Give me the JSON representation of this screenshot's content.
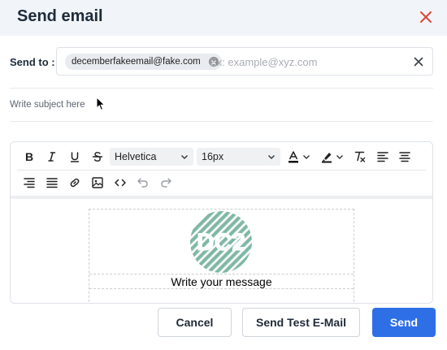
{
  "dialog": {
    "title": "Send email"
  },
  "recipients": {
    "label": "Send to :",
    "chips": [
      "decemberfakeemail@fake.com"
    ],
    "placeholder": "Ex: example@xyz.com"
  },
  "subject": {
    "placeholder": "Write subject here"
  },
  "toolbar": {
    "font_family": "Helvetica",
    "font_size": "16px",
    "buttons": [
      "bold",
      "italic",
      "underline",
      "strikethrough",
      "text-color",
      "highlight",
      "clear-format",
      "align-left",
      "align-center",
      "align-right",
      "justify",
      "link",
      "image",
      "code",
      "undo",
      "redo"
    ]
  },
  "editor": {
    "logo_text": "DC2",
    "logo_color": "#7fb8a4",
    "message_placeholder": "Write your message"
  },
  "actions": {
    "cancel_label": "Cancel",
    "test_label": "Send Test E-Mail",
    "send_label": "Send"
  },
  "colors": {
    "accent": "#2f6fe6",
    "close": "#d9473a"
  }
}
